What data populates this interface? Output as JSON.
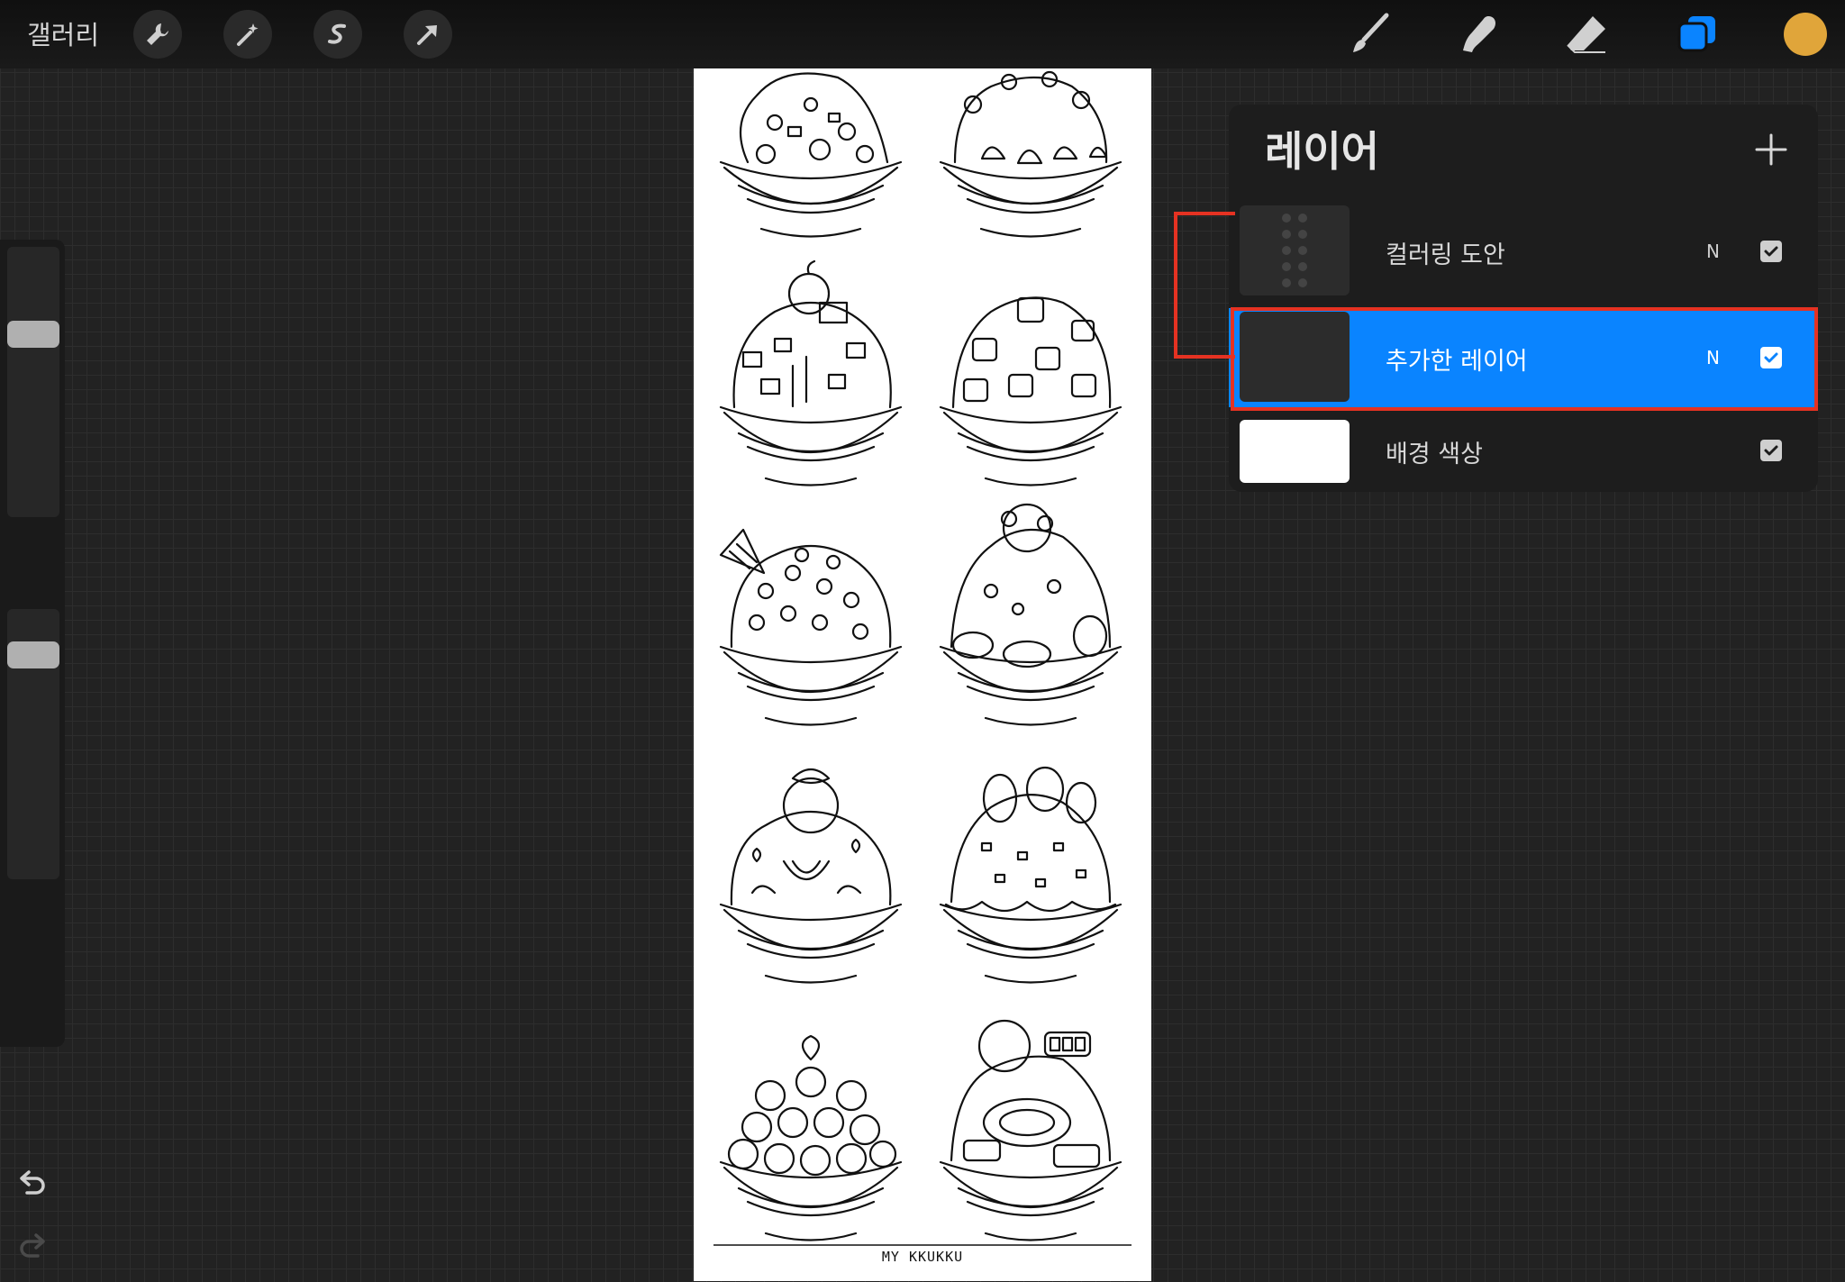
{
  "topbar": {
    "gallery_label": "갤러리",
    "left_tools": [
      {
        "icon": "wrench-icon"
      },
      {
        "icon": "magic-wand-icon"
      },
      {
        "icon": "selection-s-icon"
      },
      {
        "icon": "move-arrow-icon"
      }
    ],
    "right_tools": [
      {
        "icon": "brush-icon"
      },
      {
        "icon": "smudge-icon"
      },
      {
        "icon": "eraser-icon"
      },
      {
        "icon": "layers-icon",
        "active": true
      }
    ],
    "current_color": "#e0a53a",
    "accent_color": "#0a84ff"
  },
  "sidebar": {
    "brush_size_level": 0.3,
    "opacity_level": 0.6
  },
  "canvas": {
    "signature": "MY KKUKKU"
  },
  "layers_panel": {
    "title": "레이어",
    "add_icon": "plus-icon",
    "layers": [
      {
        "name": "컬러링 도안",
        "blend": "N",
        "visible": true,
        "selected": false
      },
      {
        "name": "추가한 레이어",
        "blend": "N",
        "visible": true,
        "selected": true
      },
      {
        "name": "배경 색상",
        "blend": "",
        "visible": true,
        "selected": false
      }
    ]
  },
  "annotation_color": "#e53222"
}
